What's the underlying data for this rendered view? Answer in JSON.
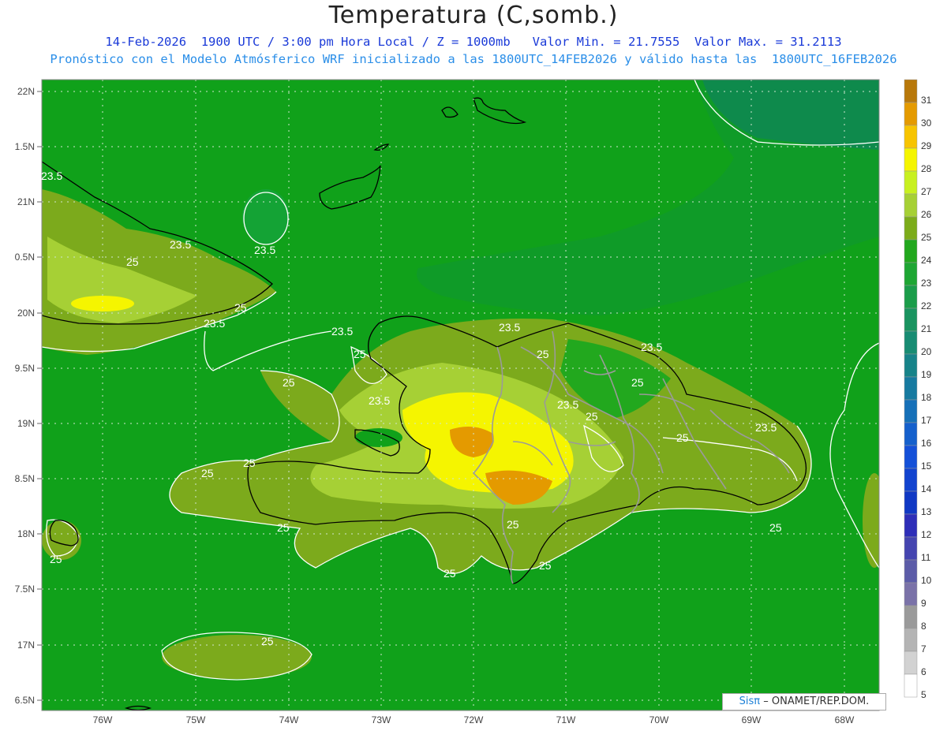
{
  "title": "Temperatura (C,somb.)",
  "subtitle_line1": "14-Feb-2026  1900 UTC / 3:00 pm Hora Local / Z = 1000mb   Valor Min. = 21.7555  Valor Max. = 31.2113",
  "subtitle_line2": "Pronóstico con el Modelo Atmósferico WRF inicializado a las 1800UTC_14FEB2026 y válido hasta las  1800UTC_16FEB2026",
  "credit": {
    "logo": "Sisπ",
    "text": "– ONAMET/REP.DOM."
  },
  "lat_labels": [
    "22N",
    "1.5N",
    "21N",
    "0.5N",
    "20N",
    "9.5N",
    "19N",
    "8.5N",
    "18N",
    "7.5N",
    "17N",
    "6.5N"
  ],
  "lon_labels": [
    "76W",
    "75W",
    "74W",
    "73W",
    "72W",
    "71W",
    "70W",
    "69W",
    "68W"
  ],
  "colorbar": {
    "labels": [
      "31",
      "30",
      "29",
      "28",
      "27",
      "26",
      "25",
      "24",
      "23",
      "22",
      "21",
      "20",
      "19",
      "18",
      "17",
      "16",
      "15",
      "14",
      "13",
      "12",
      "11",
      "10",
      "9",
      "8",
      "7",
      "6",
      "5"
    ],
    "colors": [
      "#b8780a",
      "#e49a00",
      "#f7c400",
      "#f5f500",
      "#c8f020",
      "#a6d035",
      "#7cac1a",
      "#22a81e",
      "#1ea633",
      "#1b9d4a",
      "#1a9460",
      "#188c73",
      "#178389",
      "#177aa0",
      "#1670b8",
      "#1560cc",
      "#1450d8",
      "#1243cf",
      "#1038c4",
      "#2e2eb8",
      "#4545b0",
      "#5c5ca8",
      "#7a72a8",
      "#9a9a9a",
      "#b4b4b4",
      "#d2d2d2",
      "#ffffff"
    ]
  },
  "contour_labels": [
    "23.5",
    "25"
  ],
  "colors": {
    "sea_field": "#10a11a",
    "cool_zone": "#0e8a4c",
    "warm_zone": "#7caa1c",
    "coast": "#000000",
    "borders": "#9a9a9a",
    "contour": "#ffffff"
  }
}
